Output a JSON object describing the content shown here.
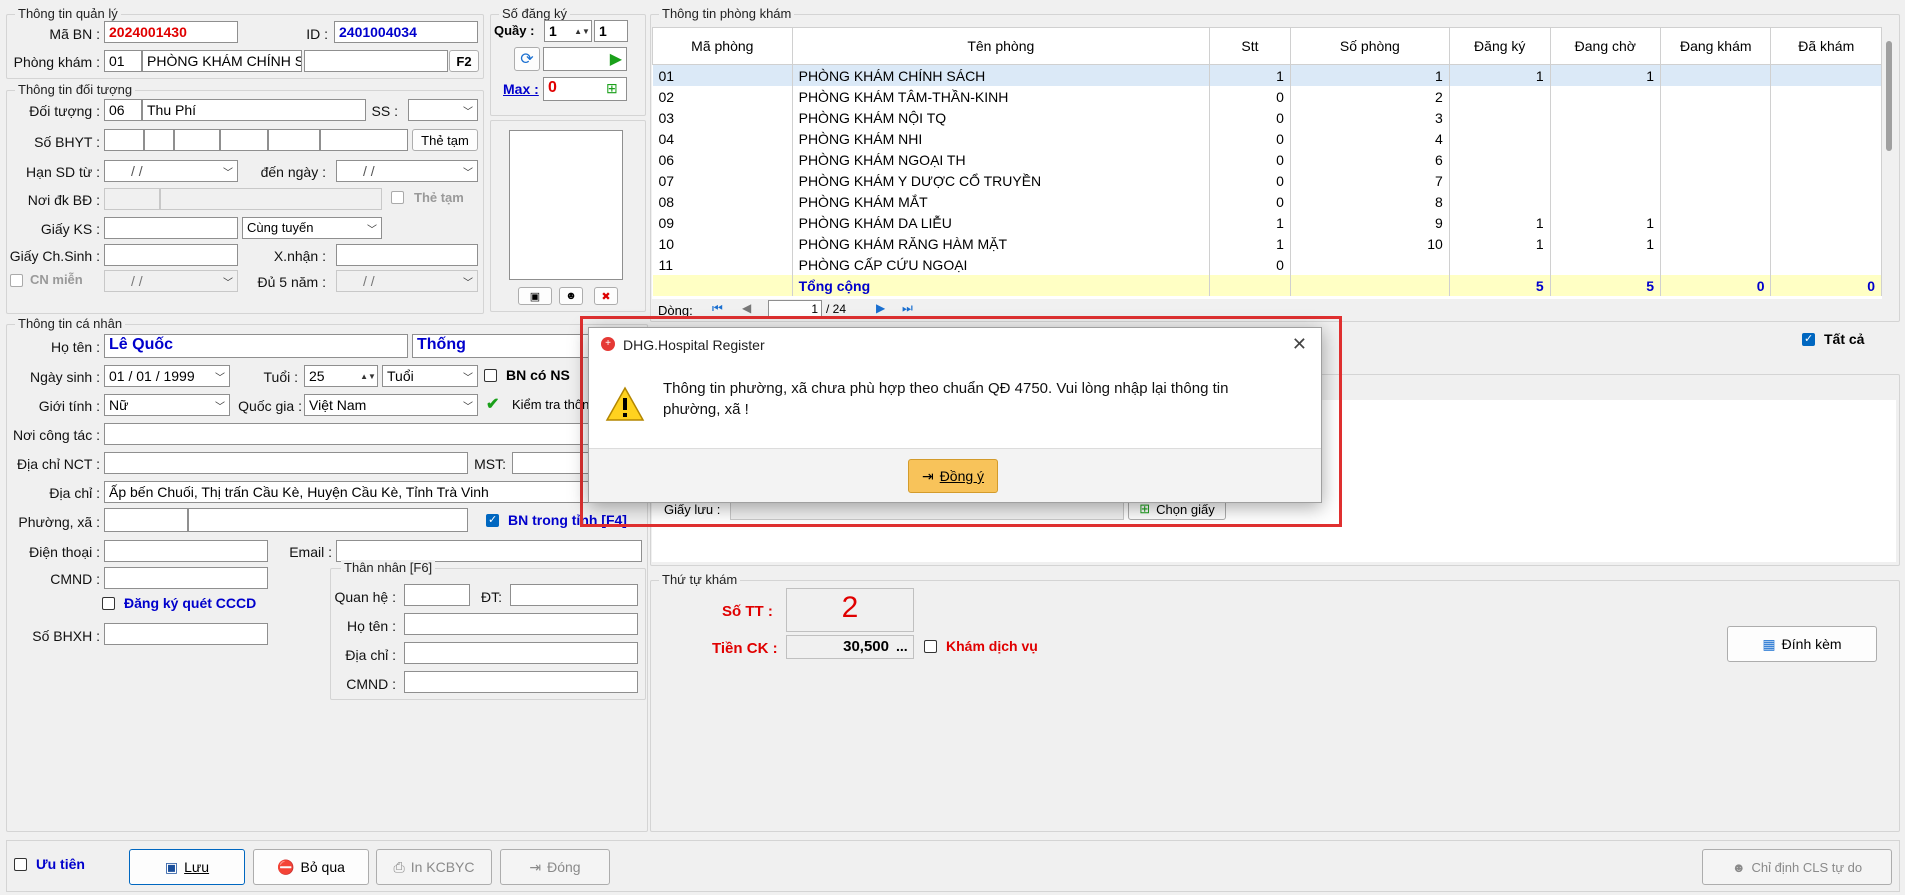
{
  "sections": {
    "quan_ly": "Thông tin quản lý",
    "so_dang_ky": "Số đăng ký",
    "phong_kham": "Thông tin phòng khám",
    "doi_tuong": "Thông tin đối tượng",
    "ca_nhan": "Thông tin cá nhân",
    "than_nhan": "Thân nhân [F6]",
    "thu_tu_kham": "Thứ tự khám"
  },
  "quan_ly": {
    "ma_bn_label": "Mã BN :",
    "ma_bn": "2024001430",
    "id_label": "ID :",
    "id": "2401004034",
    "phong_kham_label": "Phòng khám :",
    "phong_code": "01",
    "phong_name": "PHÒNG KHÁM CHÍNH S",
    "f2": "F2"
  },
  "so_dang_ky": {
    "quay_label": "Quầy :",
    "quay_val": "1",
    "quay_val2": "1",
    "max_label": "Max :",
    "max_val": "0"
  },
  "doi_tuong": {
    "doi_tuong_label": "Đối tượng :",
    "doi_tuong_code": "06",
    "doi_tuong_name": "Thu Phí",
    "ss_label": "SS :",
    "so_bhyt_label": "Số BHYT :",
    "the_tam_btn": "Thẻ tạm",
    "han_sd_label": "Hạn SD từ :",
    "date_blank": "/    /",
    "den_ngay_label": "đến  ngày :",
    "noi_dk_label": "Nơi đk BĐ :",
    "the_tam_chk": "Thẻ tạm",
    "giay_ks_label": "Giấy KS :",
    "tuyen": "Cùng tuyến",
    "giay_chsinh_label": "Giấy Ch.Sinh :",
    "xnhan_label": "X.nhận :",
    "cn_mien_label": "CN miễn",
    "du5nam_label": "Đủ 5 năm :"
  },
  "ca_nhan": {
    "ho_ten_label": "Họ tên :",
    "ho": "Lê Quốc",
    "ten": "Thống",
    "ngay_sinh_label": "Ngày sinh :",
    "ngay_sinh": "01 / 01 / 1999",
    "tuoi_label": "Tuổi :",
    "tuoi": "25",
    "tuoi_unit": "Tuổi",
    "bn_co_ns": "BN có NS",
    "gioi_tinh_label": "Giới tính :",
    "gioi_tinh": "Nữ",
    "quoc_gia_label": "Quốc gia :",
    "quoc_gia": "Việt Nam",
    "kiem_tra": "Kiểm tra thông",
    "noi_cong_tac_label": "Nơi công tác :",
    "dia_chi_nct_label": "Địa chỉ  NCT :",
    "mst_label": "MST:",
    "dia_chi_label": "Địa chỉ :",
    "dia_chi": "Ấp bến Chuối, Thị trấn Cầu Kè, Huyện Cầu Kè, Tỉnh Trà Vinh",
    "phuong_xa_label": "Phường, xã :",
    "bn_trong_tinh": "BN trong tỉnh [F4]",
    "dien_thoai_label": "Điện thoại :",
    "email_label": "Email :",
    "cmnd_label": "CMND :",
    "dang_ky_cccd": "Đăng ký quét CCCD",
    "so_bhxh_label": "Số BHXH :"
  },
  "than_nhan": {
    "quan_he_label": "Quan hệ :",
    "dt_label": "ĐT:",
    "ho_ten_label": "Họ tên :",
    "dia_chi_label": "Địa chỉ :",
    "cmnd_label": "CMND :"
  },
  "table": {
    "headers": [
      "Mã phòng",
      "Tên phòng",
      "Stt",
      "Số phòng",
      "Đăng ký",
      "Đang chờ",
      "Đang khám",
      "Đã khám"
    ],
    "rows": [
      [
        "01",
        "PHÒNG KHÁM CHÍNH SÁCH",
        "1",
        "1",
        "1",
        "1",
        "",
        ""
      ],
      [
        "02",
        "PHÒNG KHÁM TÂM-THẦN-KINH",
        "0",
        "2",
        "",
        "",
        "",
        ""
      ],
      [
        "03",
        "PHÒNG KHÁM NỘI TQ",
        "0",
        "3",
        "",
        "",
        "",
        ""
      ],
      [
        "04",
        "PHÒNG KHÁM NHI",
        "0",
        "4",
        "",
        "",
        "",
        ""
      ],
      [
        "06",
        "PHÒNG KHÁM NGOẠI TH",
        "0",
        "6",
        "",
        "",
        "",
        ""
      ],
      [
        "07",
        "PHÒNG KHÁM Y DƯỢC CỔ TRUYỀN",
        "0",
        "7",
        "",
        "",
        "",
        ""
      ],
      [
        "08",
        "PHÒNG KHÁM MẮT",
        "0",
        "8",
        "",
        "",
        "",
        ""
      ],
      [
        "09",
        "PHÒNG KHÁM DA LIỄU",
        "1",
        "9",
        "1",
        "1",
        "",
        ""
      ],
      [
        "10",
        "PHÒNG KHÁM RĂNG HÀM MẶT",
        "1",
        "10",
        "1",
        "1",
        "",
        ""
      ],
      [
        "11",
        "PHÒNG CẤP CỨU NGOẠI",
        "0",
        "",
        "",
        "",
        "",
        ""
      ]
    ],
    "total": [
      "",
      "Tổng cộng",
      "",
      "",
      "5",
      "5",
      "0",
      "0"
    ],
    "dong_label": "Dòng:",
    "page": "1",
    "page_total": "/   24",
    "tat_ca": "Tất cả"
  },
  "giay": {
    "giay_luu_label": "Giấy lưu :",
    "chon_giay": "Chọn giấy"
  },
  "thu_tu": {
    "so_tt_label": "Số TT :",
    "so_tt": "2",
    "tien_ck_label": "Tiền CK :",
    "tien_ck": "30,500",
    "dots": "...",
    "kham_dich_vu": "Khám dịch vụ",
    "dinh_kem": "Đính kèm"
  },
  "footer": {
    "uu_tien": "Ưu tiên",
    "luu": "Lưu",
    "bo_qua": "Bỏ qua",
    "in_kcbyc": "In KCBYC",
    "dong": "Đóng",
    "chi_dinh": "Chỉ định CLS tự do"
  },
  "dialog": {
    "title": "DHG.Hospital Register",
    "message": "Thông tin phường, xã chưa phù hợp theo chuẩn QĐ 4750. Vui lòng nhập lại thông tin phường, xã !",
    "ok": "Đồng ý"
  },
  "colors": {
    "red": "#e00000",
    "blue": "#0000cc",
    "highlight": "#e03030"
  }
}
